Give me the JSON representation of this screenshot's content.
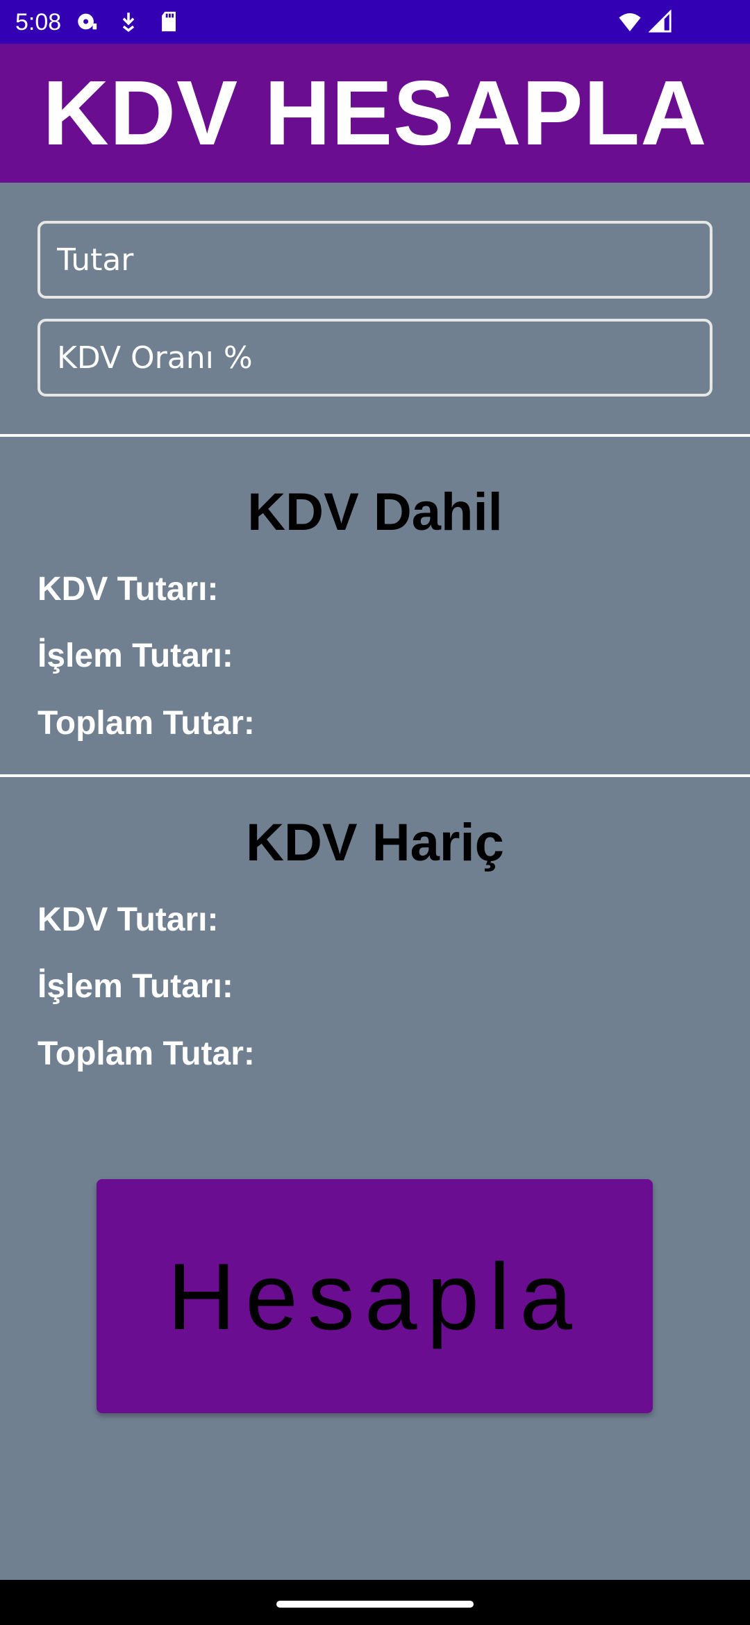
{
  "status_bar": {
    "time": "5:08",
    "icons": [
      "media-icon",
      "download-icon",
      "sd-card-icon",
      "wifi-icon",
      "signal-icon"
    ]
  },
  "app_bar": {
    "title": "KDV HESAPLA"
  },
  "inputs": {
    "amount_placeholder": "Tutar",
    "amount_value": "",
    "rate_placeholder": "KDV Oranı %",
    "rate_value": ""
  },
  "included_section": {
    "title": "KDV Dahil",
    "vat_amount_label": "KDV Tutarı:",
    "vat_amount_value": "",
    "transaction_amount_label": "İşlem Tutarı:",
    "transaction_amount_value": "",
    "total_amount_label": "Toplam Tutar:",
    "total_amount_value": ""
  },
  "excluded_section": {
    "title": "KDV Hariç",
    "vat_amount_label": "KDV Tutarı:",
    "vat_amount_value": "",
    "transaction_amount_label": "İşlem Tutarı:",
    "transaction_amount_value": "",
    "total_amount_label": "Toplam Tutar:",
    "total_amount_value": ""
  },
  "calculate_button": {
    "label": "Hesapla"
  },
  "colors": {
    "status_bar": "#3300b3",
    "app_bar": "#6a0d91",
    "background": "#708090",
    "button": "#6a0d91"
  }
}
